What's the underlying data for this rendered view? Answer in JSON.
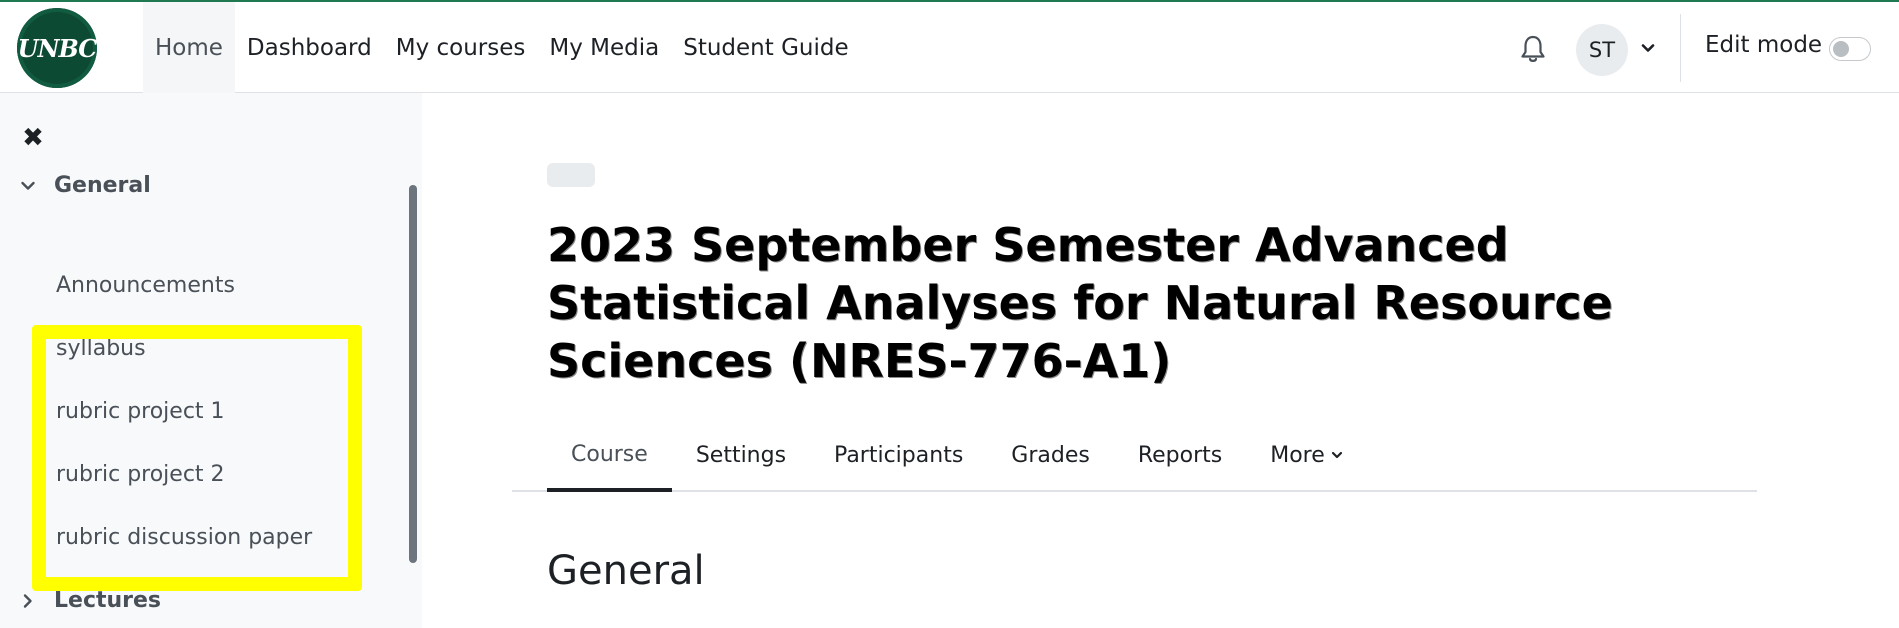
{
  "logo": {
    "text": "UNBC"
  },
  "primary_nav": {
    "items": [
      {
        "label": "Home",
        "active": true
      },
      {
        "label": "Dashboard"
      },
      {
        "label": "My courses"
      },
      {
        "label": "My Media"
      },
      {
        "label": "Student Guide"
      }
    ]
  },
  "user_menu": {
    "notifications_icon": "bell-icon",
    "initials": "ST",
    "caret_icon": "chevron-down-icon"
  },
  "edit_mode": {
    "label": "Edit mode",
    "enabled": false
  },
  "drawer": {
    "close_icon": "close-icon",
    "sections": [
      {
        "label": "General",
        "expanded": true,
        "items": [
          "Announcements",
          "syllabus",
          "rubric project 1",
          "rubric project 2",
          "rubric discussion paper"
        ]
      },
      {
        "label": "Lectures",
        "expanded": false
      }
    ],
    "highlight_color": "#ffff00"
  },
  "course": {
    "title": "2023 September Semester Advanced Statistical Analyses for Natural Resource Sciences (NRES-776-A1)",
    "tabs": [
      {
        "label": "Course",
        "active": true
      },
      {
        "label": "Settings"
      },
      {
        "label": "Participants"
      },
      {
        "label": "Grades"
      },
      {
        "label": "Reports"
      },
      {
        "label": "More",
        "has_dropdown": true
      }
    ],
    "section_title": "General"
  },
  "colors": {
    "brand_green": "#0d4a33",
    "accent_top_border": "#1f7a52",
    "drawer_bg": "#f8f9fa"
  }
}
